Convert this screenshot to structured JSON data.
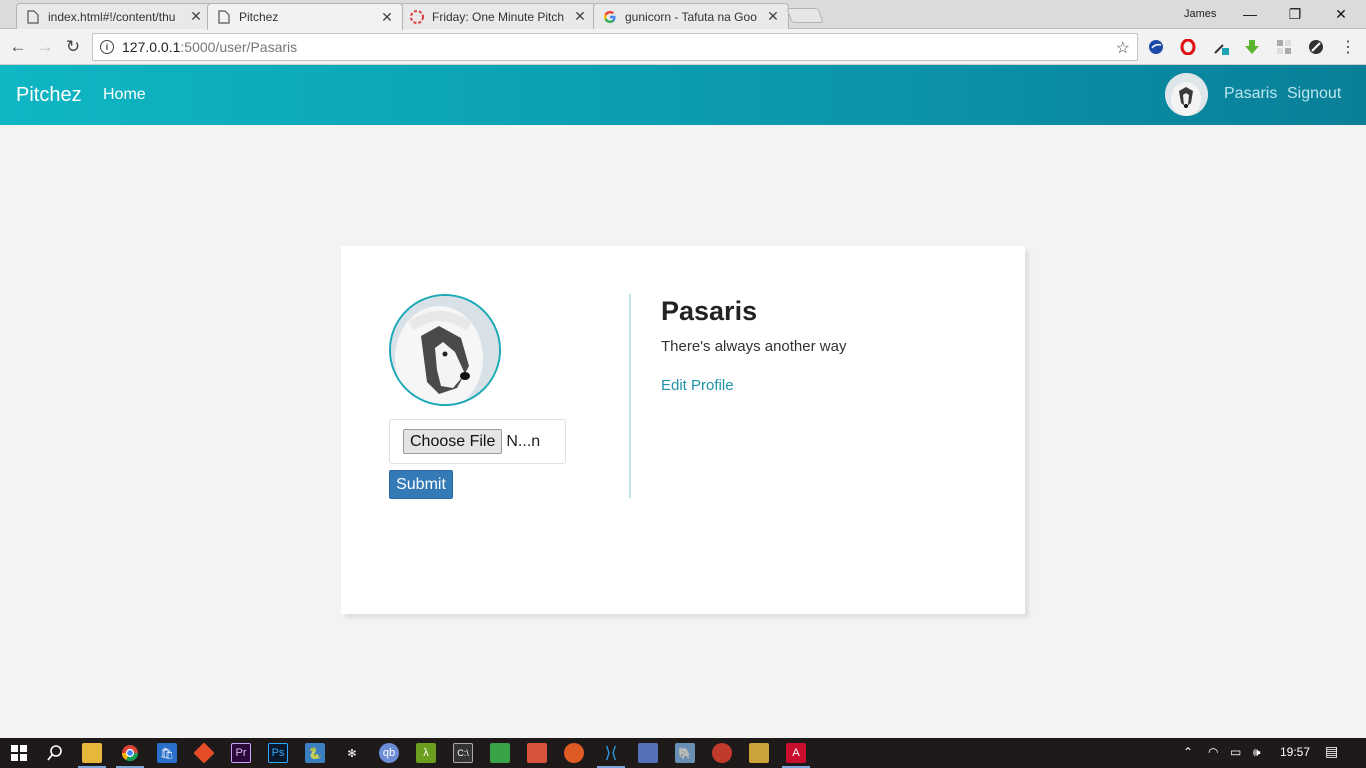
{
  "browser": {
    "tabs": [
      {
        "title": "index.html#!/content/thu",
        "icon": "page-icon",
        "active": false
      },
      {
        "title": "Pitchez",
        "icon": "page-icon",
        "active": true
      },
      {
        "title": "Friday: One Minute Pitch",
        "icon": "loading-icon",
        "active": false
      },
      {
        "title": "gunicorn - Tafuta na Goo",
        "icon": "google-icon",
        "active": false
      }
    ],
    "profile_name": "James",
    "url_host": "127.0.0.1",
    "url_path": ":5000/user/Pasaris"
  },
  "navbar": {
    "brand": "Pitchez",
    "home": "Home",
    "user": "Pasaris",
    "signout": "Signout",
    "gradient_start": "#0fb6c4",
    "gradient_end": "#0a7f98"
  },
  "profile": {
    "file_button": "Choose File",
    "file_name": "N...n",
    "submit": "Submit",
    "name": "Pasaris",
    "bio": "There's always another way",
    "edit_link": "Edit Profile"
  },
  "taskbar": {
    "time": "19:57"
  }
}
